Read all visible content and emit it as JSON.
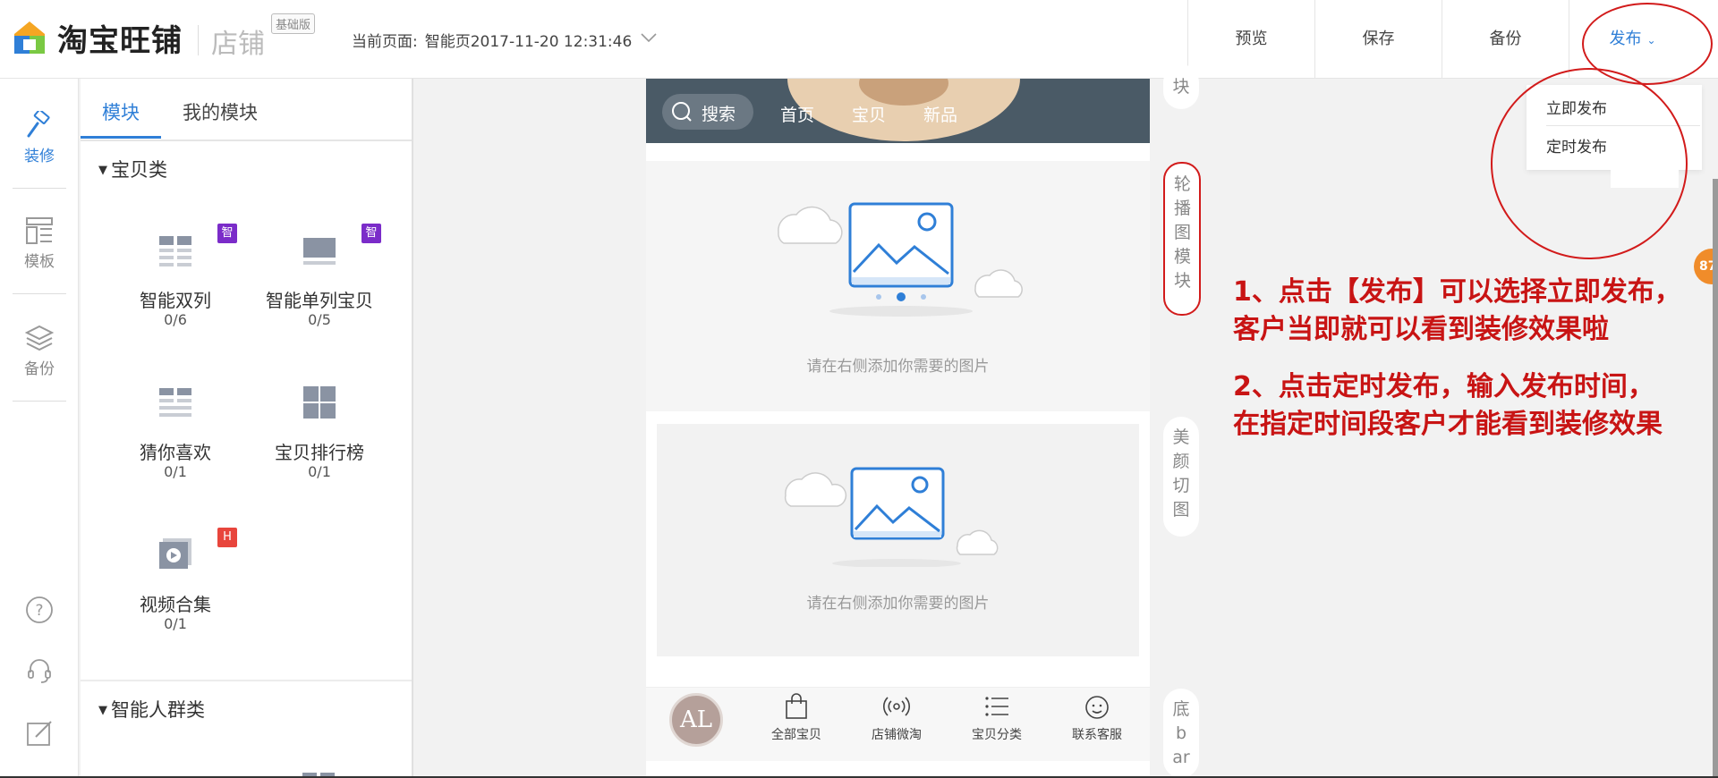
{
  "app": {
    "logo_text": "淘宝旺铺",
    "logo_sub": "店铺",
    "edition": "基础版"
  },
  "header": {
    "current_page_label": "当前页面:",
    "current_page_value": "智能页2017-11-20 12:31:46",
    "actions": {
      "preview": "预览",
      "save": "保存",
      "backup": "备份",
      "publish": "发布"
    }
  },
  "publish_menu": {
    "items": [
      "立即发布",
      "定时发布"
    ]
  },
  "leftnav": {
    "items": [
      {
        "label": "装修"
      },
      {
        "label": "模板"
      },
      {
        "label": "备份"
      }
    ]
  },
  "panel": {
    "tabs": [
      "模块",
      "我的模块"
    ],
    "categories": [
      {
        "title": "宝贝类"
      },
      {
        "title": "智能人群类"
      }
    ],
    "modules": [
      {
        "name": "智能双列",
        "count": "0/6",
        "badge": "智"
      },
      {
        "name": "智能单列宝贝",
        "count": "0/5",
        "badge": "智"
      },
      {
        "name": "猜你喜欢",
        "count": "0/1"
      },
      {
        "name": "宝贝排行榜",
        "count": "0/1"
      },
      {
        "name": "视频合集",
        "count": "0/1",
        "badge": "H"
      }
    ],
    "badge_colors": {
      "zhi": "#7b2cc9",
      "h": "#e8453c"
    }
  },
  "phone": {
    "search_label": "搜索",
    "nav_links": [
      "首页",
      "宝贝",
      "新品"
    ],
    "slot_hint": "请在右侧添加你需要的图片",
    "avatar_text": "AL",
    "tabbar": [
      "全部宝贝",
      "店铺微淘",
      "宝贝分类",
      "联系客服"
    ]
  },
  "side_labels": {
    "top_partial": "块",
    "carousel": "轮播图模块",
    "beauty": "美颜切图",
    "bottom": "底bar"
  },
  "annotations": {
    "line1": "1、点击【发布】可以选择立即发布，",
    "line2": "客户当即就可以看到装修效果啦",
    "line3": "2、点击定时发布，输入发布时间，",
    "line4": "在指定时间段客户才能看到装修效果"
  },
  "float_badge": "87",
  "colors": {
    "accent": "#2f7fd7",
    "annotation": "#c81414",
    "phone_nav": "#4a5a66"
  }
}
